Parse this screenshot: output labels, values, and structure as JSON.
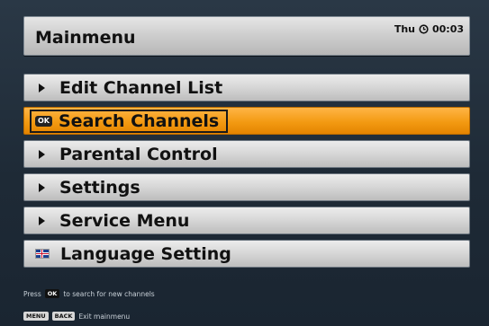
{
  "header": {
    "title": "Mainmenu",
    "day": "Thu",
    "time": "00:03"
  },
  "menu": {
    "items": [
      {
        "label": "Edit Channel List",
        "icon": "arrow-right-icon"
      },
      {
        "label": "Search Channels",
        "icon": "ok-key-icon",
        "selected": true
      },
      {
        "label": "Parental Control",
        "icon": "arrow-right-icon"
      },
      {
        "label": "Settings",
        "icon": "arrow-right-icon"
      },
      {
        "label": "Service Menu",
        "icon": "arrow-right-icon"
      },
      {
        "label": "Language Setting",
        "icon": "uk-flag-icon"
      }
    ]
  },
  "footer": {
    "hint_prefix": "Press",
    "ok_key": "OK",
    "hint_suffix": "to search for new channels",
    "menu_key": "MENU",
    "back_key": "BACK",
    "exit_text": "Exit mainmenu"
  },
  "colors": {
    "background": "#1f2a35",
    "selected": "#f39a12",
    "item": "#d6d6d6"
  }
}
